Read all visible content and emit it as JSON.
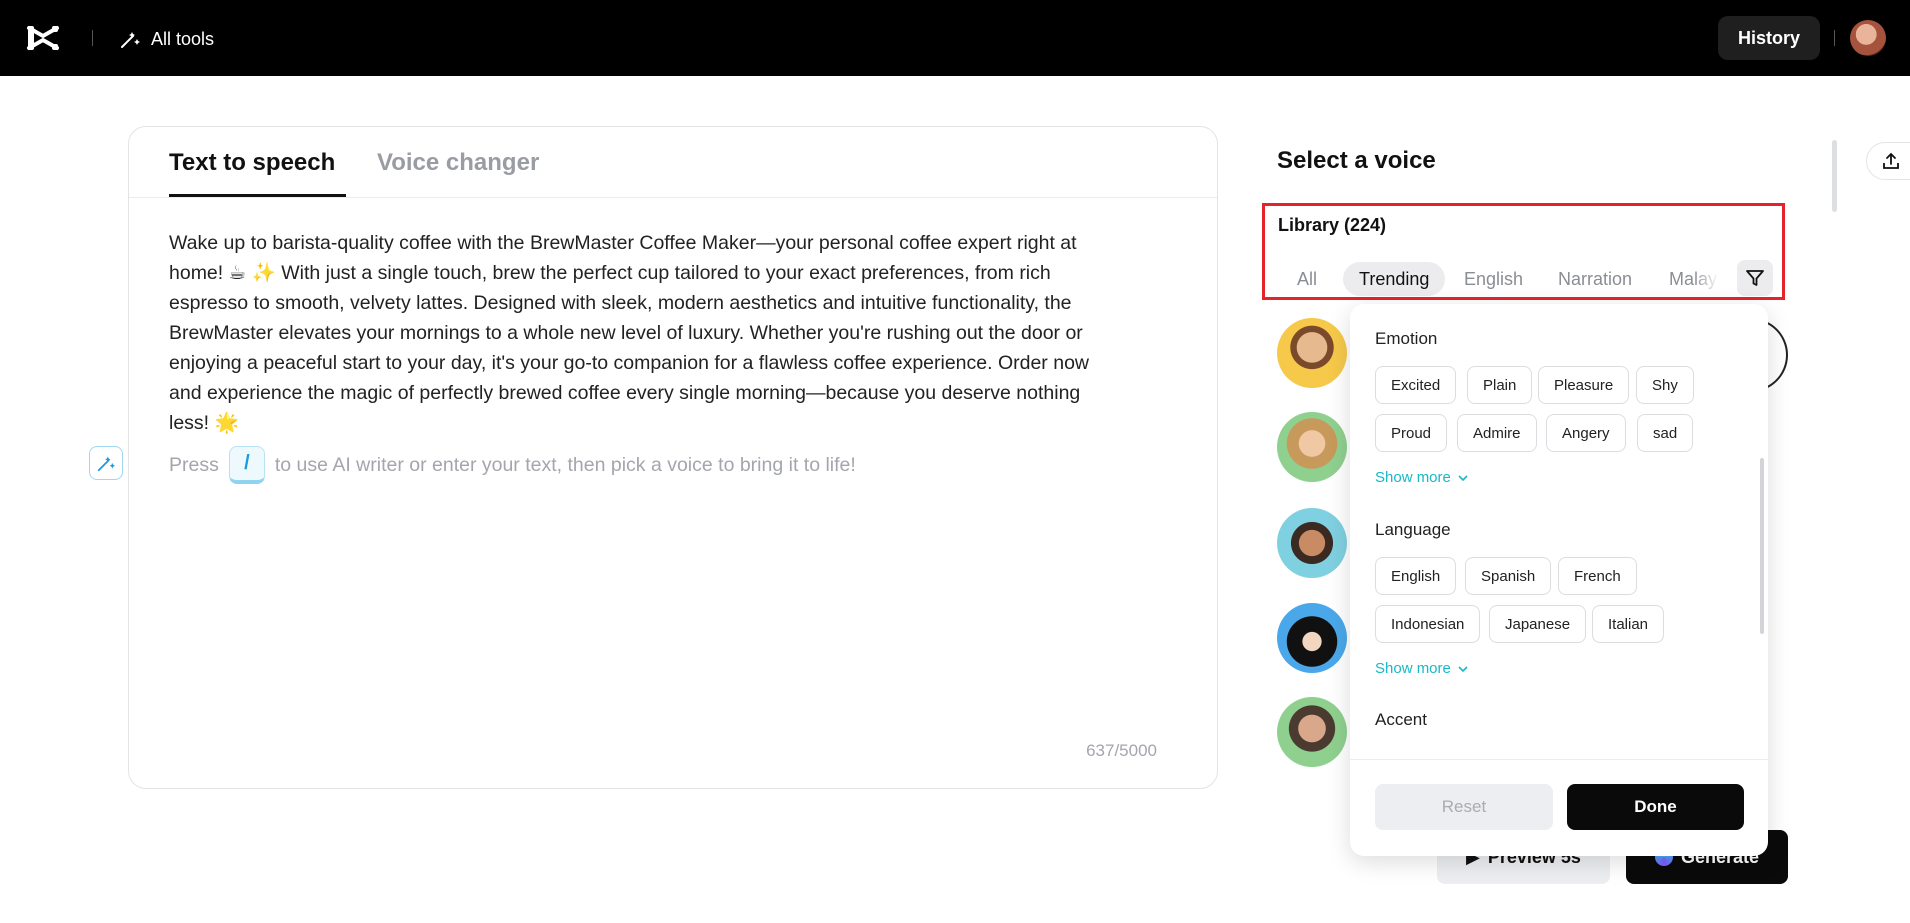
{
  "topbar": {
    "all_tools_label": "All tools",
    "history_label": "History"
  },
  "editor": {
    "tabs": [
      {
        "label": "Text to speech",
        "active": true
      },
      {
        "label": "Voice changer",
        "active": false
      }
    ],
    "text_lines": [
      "Wake up to barista-quality coffee with the BrewMaster Coffee Maker—your personal coffee expert right at",
      "home! ☕ ✨ With just a single touch, brew the perfect cup tailored to your exact preferences, from rich",
      "espresso to smooth, velvety lattes. Designed with sleek, modern aesthetics and intuitive functionality, the",
      "BrewMaster elevates your mornings to a whole new level of luxury. Whether you're rushing out the door or",
      "enjoying a peaceful start to your day, it's your go-to companion for a flawless coffee experience. Order now",
      "and experience the magic of perfectly brewed coffee every single morning—because you deserve nothing",
      "less! 🌟"
    ],
    "ai_hint_prefix": "Press",
    "ai_hint_key": "/",
    "ai_hint_suffix": "to use AI writer or enter your text, then pick a voice to bring it to life!",
    "char_count": "637/5000"
  },
  "voice_panel": {
    "title": "Select a voice",
    "library_title": "Library (224)",
    "library_tabs": [
      {
        "label": "All",
        "active": false
      },
      {
        "label": "Trending",
        "active": true
      },
      {
        "label": "English",
        "active": false
      },
      {
        "label": "Narration",
        "active": false
      },
      {
        "label": "Malay",
        "active": false
      }
    ]
  },
  "filter_dropdown": {
    "emotion_title": "Emotion",
    "emotion_chips": [
      "Excited",
      "Plain",
      "Pleasure",
      "Shy",
      "Proud",
      "Admire",
      "Angery",
      "sad"
    ],
    "language_title": "Language",
    "language_chips": [
      "English",
      "Spanish",
      "French",
      "Indonesian",
      "Japanese",
      "Italian"
    ],
    "show_more_label": "Show more",
    "accent_title": "Accent",
    "reset_label": "Reset",
    "done_label": "Done"
  },
  "actions": {
    "preview_label": "Preview 5s",
    "generate_label": "Generate"
  },
  "colors": {
    "accent_teal": "#18b9c7",
    "highlight_red": "#e3242b",
    "topbar_bg": "#000000"
  }
}
